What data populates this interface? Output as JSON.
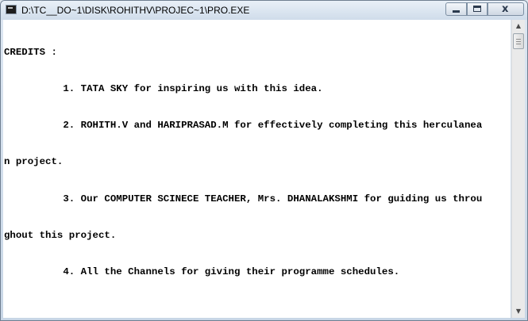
{
  "window": {
    "title": "D:\\TC__DO~1\\DISK\\ROHITHV\\PROJEC~1\\PRO.EXE",
    "controls": {
      "minimize": "minimize-icon",
      "maximize": "maximize-icon",
      "close": "close-icon"
    }
  },
  "console": {
    "lines": [
      "CREDITS :",
      "          1. TATA SKY for inspiring us with this idea.",
      "          2. ROHITH.V and HARIPRASAD.M for effectively completing this herculanea",
      "n project.",
      "          3. Our COMPUTER SCINECE TEACHER, Mrs. DHANALAKSHMI for guiding us throu",
      "ghout this project.",
      "          4. All the Channels for giving their programme schedules."
    ]
  },
  "scrollbar": {
    "up_icon": "scroll-up-arrow-icon",
    "down_icon": "scroll-down-arrow-icon"
  }
}
